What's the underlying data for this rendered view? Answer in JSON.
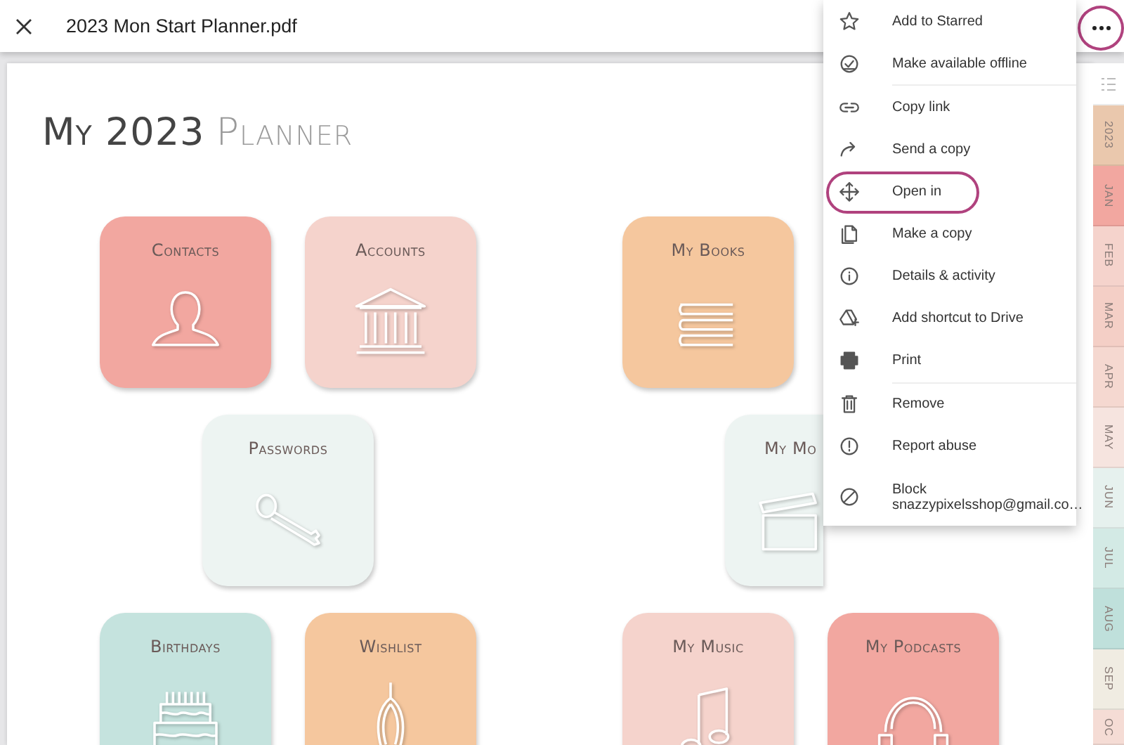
{
  "app_bar": {
    "title": "2023 Mon Start Planner.pdf",
    "more_button": {
      "highlighted": true
    }
  },
  "page": {
    "title_main": "My 2023",
    "title_accent": "Planner",
    "tiles": [
      {
        "label": "Contacts",
        "color": "#f2a7a0"
      },
      {
        "label": "Accounts",
        "color": "#f5d3cc"
      },
      {
        "label": "My Books",
        "color": "#f5c79e"
      },
      {
        "label": "Passwords",
        "color": "#edf4f2"
      },
      {
        "label": "My Mo",
        "color": "#edf4f2"
      },
      {
        "label": "Birthdays",
        "color": "#c5e3de"
      },
      {
        "label": "Wishlist",
        "color": "#f5c79e"
      },
      {
        "label": "My Music",
        "color": "#f5d3cc"
      },
      {
        "label": "My Podcasts",
        "color": "#f2a7a0"
      }
    ]
  },
  "side_tabs": [
    {
      "kind": "index"
    },
    {
      "kind": "month",
      "label": "2023",
      "color": "#eac8ad"
    },
    {
      "kind": "month",
      "label": "JAN",
      "color": "#f2a7a0"
    },
    {
      "kind": "month",
      "label": "FEB",
      "color": "#f5d3cc"
    },
    {
      "kind": "month",
      "label": "MAR",
      "color": "#f4cfc6"
    },
    {
      "kind": "month",
      "label": "APR",
      "color": "#f5d8d0"
    },
    {
      "kind": "month",
      "label": "MAY",
      "color": "#f6e4df"
    },
    {
      "kind": "month",
      "label": "JUN",
      "color": "#e6f1ee"
    },
    {
      "kind": "month",
      "label": "JUL",
      "color": "#d3eae5"
    },
    {
      "kind": "month",
      "label": "AUG",
      "color": "#bfe0db"
    },
    {
      "kind": "month",
      "label": "SEP",
      "color": "#f0ece2"
    },
    {
      "kind": "month",
      "label": "OC",
      "color": "#f5dcd5"
    }
  ],
  "menu": {
    "items": [
      {
        "label": "Add to Starred",
        "highlighted": false
      },
      {
        "label": "Make available offline",
        "highlighted": false
      },
      {
        "label": "Copy link",
        "highlighted": false
      },
      {
        "label": "Send a copy",
        "highlighted": false
      },
      {
        "label": "Open in",
        "highlighted": true
      },
      {
        "label": "Make a copy",
        "highlighted": false
      },
      {
        "label": "Details & activity",
        "highlighted": false
      },
      {
        "label": "Add shortcut to Drive",
        "highlighted": false
      },
      {
        "label": "Print",
        "highlighted": false
      },
      {
        "label": "Remove",
        "highlighted": false
      },
      {
        "label": "Report abuse",
        "highlighted": false
      },
      {
        "label": "Block",
        "sublabel": "snazzypixelsshop@gmail.co…",
        "highlighted": false
      }
    ]
  }
}
